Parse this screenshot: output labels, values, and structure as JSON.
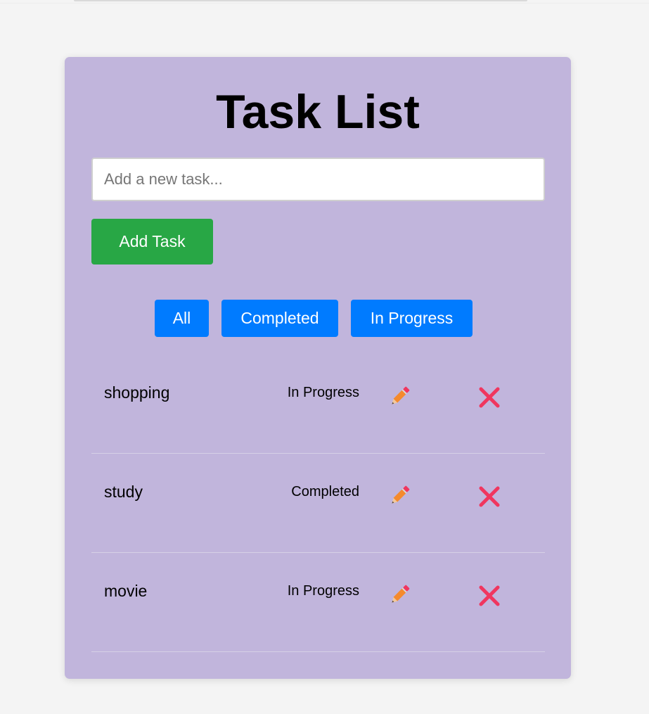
{
  "header": {
    "title": "Task List"
  },
  "new_task": {
    "placeholder": "Add a new task...",
    "value": "",
    "add_label": "Add Task"
  },
  "filters": {
    "all_label": "All",
    "completed_label": "Completed",
    "in_progress_label": "In Progress"
  },
  "tasks": [
    {
      "name": "shopping",
      "status": "In Progress"
    },
    {
      "name": "study",
      "status": "Completed"
    },
    {
      "name": "movie",
      "status": "In Progress"
    }
  ],
  "icons": {
    "edit": "pencil-icon",
    "delete": "cross-mark-icon"
  },
  "colors": {
    "page_background": "#f4f4f4",
    "card_background": "#c1b5dc",
    "add_button": "#28a745",
    "filter_button": "#007bff",
    "delete_icon": "#f0365f",
    "edit_icon": "#f58a2d"
  }
}
